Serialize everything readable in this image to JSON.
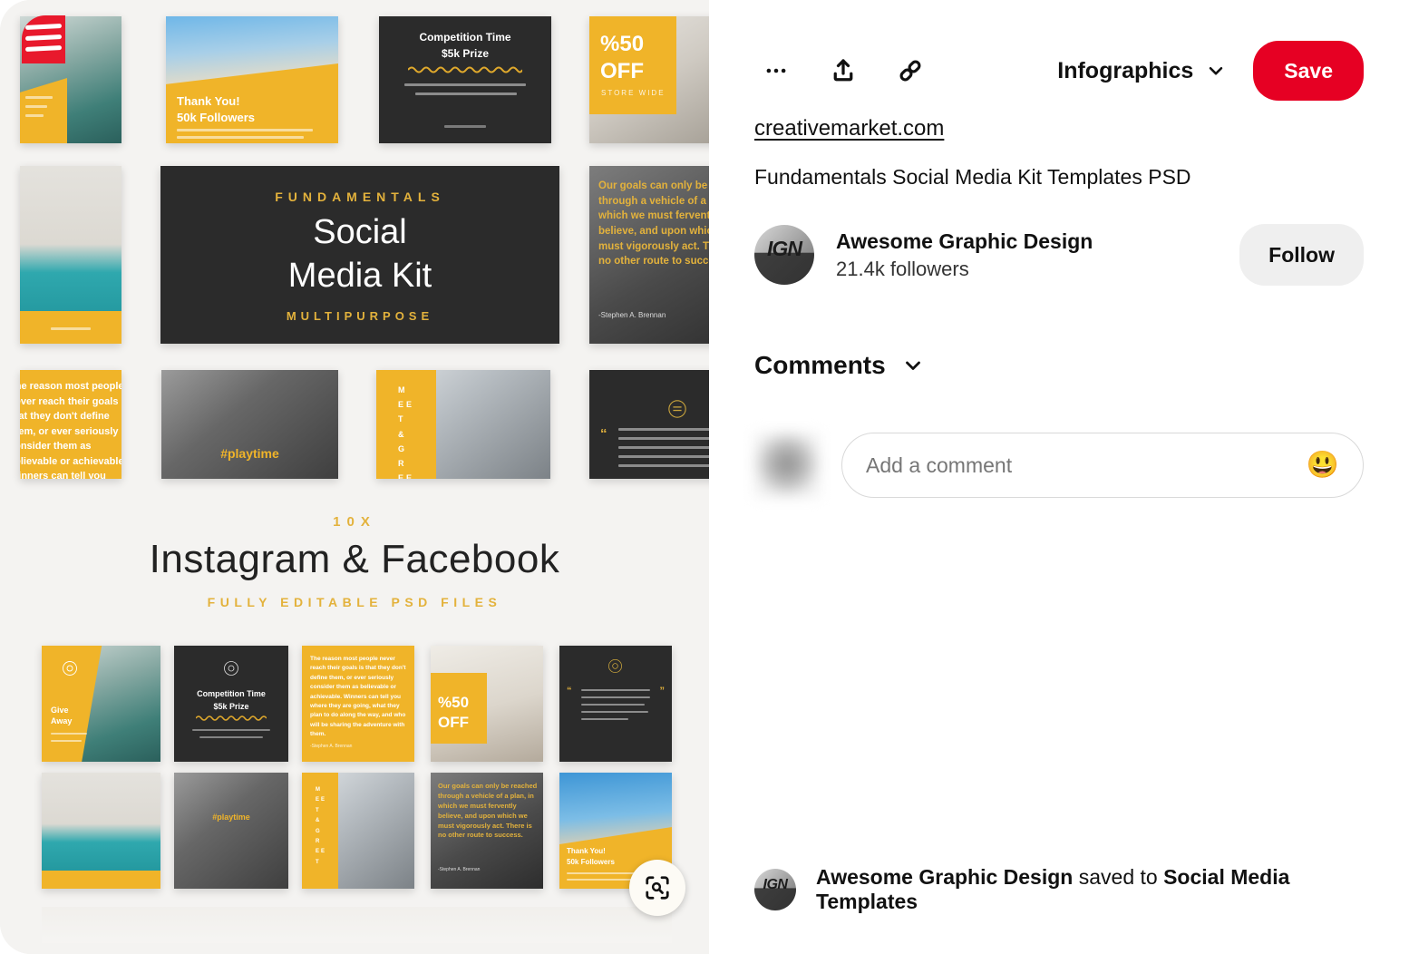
{
  "pin": {
    "source_domain": "creativemarket.com",
    "title": "Fundamentals Social Media Kit Templates PSD"
  },
  "actions": {
    "more_icon": "ellipsis-icon",
    "share_icon": "share-upload-icon",
    "link_icon": "chain-link-icon",
    "board_name": "Infographics",
    "board_chevron": "chevron-down-icon",
    "save_label": "Save"
  },
  "creator": {
    "avatar_text": "IGN",
    "name": "Awesome Graphic Design",
    "followers": "21.4k followers",
    "follow_label": "Follow"
  },
  "comments": {
    "heading": "Comments",
    "chevron": "chevron-down-icon",
    "input_placeholder": "Add a comment",
    "input_value": "",
    "emoji": "😃"
  },
  "saved_bar": {
    "avatar_text": "IGN",
    "user": "Awesome Graphic Design",
    "connector": " saved to ",
    "board": "Social Media Templates"
  },
  "image_pane": {
    "lens_icon": "visual-search-lens-icon",
    "hero": {
      "eyebrow": "10X",
      "headline": "Instagram & Facebook",
      "subline": "FULLY EDITABLE PSD FILES"
    },
    "templates": {
      "kit_eyebrow": "FUNDAMENTALS",
      "kit_title_line1": "Social",
      "kit_title_line2": "Media Kit",
      "kit_footer": "MULTIPURPOSE",
      "thanks_line1": "Thank You!",
      "thanks_line2": "50k Followers",
      "competition_line1": "Competition Time",
      "competition_line2": "$5k Prize",
      "offer_line1": "%50",
      "offer_line2": "OFF",
      "offer_sub": "STORE WIDE",
      "quote_goals": "Our goals can only be reached through a vehicle of a plan, in which we must fervently believe, and upon which we must vigorously act. There is no other route to success.",
      "quote_goals_author": "-Stephen A. Brennan",
      "quote_people": "The reason most people never reach their goals is that they don't define them, or ever seriously consider them as believable or achievable. Winners can tell you where they are going, what they plan to do along the way, and who will be sharing the adventure with them.",
      "playtime": "#playtime",
      "meet_greet": "MEET & GREET",
      "giveaway_line1": "Give",
      "giveaway_line2": "Away"
    }
  },
  "colors": {
    "brand_red": "#e60023",
    "accent_yellow": "#f0b429",
    "dark": "#2b2b2b",
    "follow_bg": "#efefef",
    "pane_bg": "#f4f3f1"
  }
}
